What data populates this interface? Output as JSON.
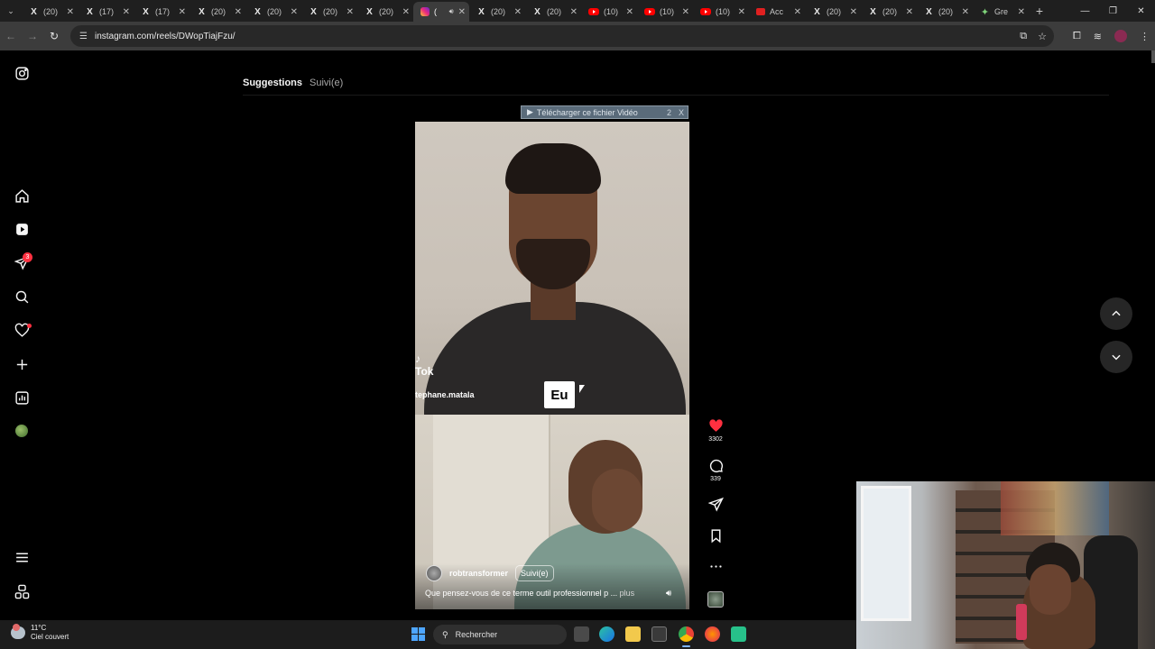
{
  "browser": {
    "tabs": [
      {
        "icon": "x-icon",
        "label": "(20)",
        "active": false
      },
      {
        "icon": "x-icon",
        "label": "(17)",
        "active": false
      },
      {
        "icon": "x-icon",
        "label": "(17)",
        "active": false
      },
      {
        "icon": "x-icon",
        "label": "(20)",
        "active": false
      },
      {
        "icon": "x-icon",
        "label": "(20)",
        "active": false
      },
      {
        "icon": "x-icon",
        "label": "(20)",
        "active": false
      },
      {
        "icon": "x-icon",
        "label": "(20)",
        "active": false
      },
      {
        "icon": "instagram-icon",
        "label": "(",
        "active": true
      },
      {
        "icon": "x-icon",
        "label": "(20)",
        "active": false
      },
      {
        "icon": "x-icon",
        "label": "(20)",
        "active": false
      },
      {
        "icon": "youtube-icon",
        "label": "(10)",
        "active": false
      },
      {
        "icon": "youtube-icon",
        "label": "(10)",
        "active": false
      },
      {
        "icon": "youtube-icon",
        "label": "(10)",
        "active": false
      },
      {
        "icon": "red-icon",
        "label": "Acc",
        "active": false
      },
      {
        "icon": "x-icon",
        "label": "(20)",
        "active": false
      },
      {
        "icon": "x-icon",
        "label": "(20)",
        "active": false
      },
      {
        "icon": "x-icon",
        "label": "(20)",
        "active": false
      },
      {
        "icon": "gemini-icon",
        "label": "Gre",
        "active": false
      }
    ],
    "url": "instagram.com/reels/DWopTiajFzu/"
  },
  "instagram": {
    "feed_tabs": {
      "suggestions": "Suggestions",
      "following": "Suivi(e)"
    },
    "download_banner": {
      "label": "Télécharger ce fichier Vidéo",
      "count": "2",
      "close": "X"
    },
    "video": {
      "watermark_brand": "Tok",
      "watermark_user": "tephane.matala",
      "caption_word": "Eu",
      "author": "robtransformer",
      "follow_label": "Suivi(e)",
      "caption": "Que pensez-vous de ce terme outil professionnel p ...",
      "more_label": "plus"
    },
    "actions": {
      "likes": "3302",
      "comments": "339"
    },
    "notifications_badge": "3"
  },
  "taskbar": {
    "weather_temp": "11°C",
    "weather_desc": "Ciel couvert",
    "search_placeholder": "Rechercher"
  },
  "colors": {
    "like_red": "#ff3040",
    "page_bg": "#000000",
    "chrome_dark": "#1f1f1f"
  }
}
